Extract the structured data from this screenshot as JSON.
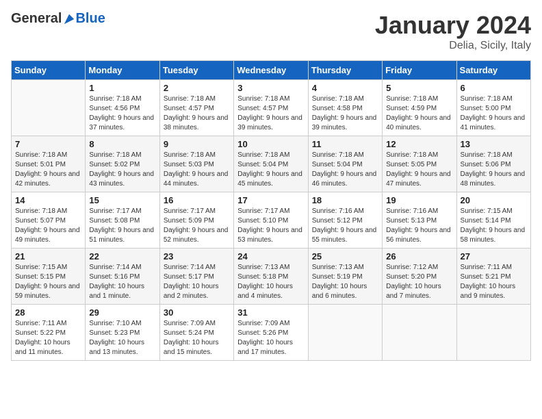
{
  "header": {
    "logo_general": "General",
    "logo_blue": "Blue",
    "month_title": "January 2024",
    "location": "Delia, Sicily, Italy"
  },
  "weekdays": [
    "Sunday",
    "Monday",
    "Tuesday",
    "Wednesday",
    "Thursday",
    "Friday",
    "Saturday"
  ],
  "weeks": [
    [
      {
        "day": "",
        "sunrise": "",
        "sunset": "",
        "daylight": ""
      },
      {
        "day": "1",
        "sunrise": "Sunrise: 7:18 AM",
        "sunset": "Sunset: 4:56 PM",
        "daylight": "Daylight: 9 hours and 37 minutes."
      },
      {
        "day": "2",
        "sunrise": "Sunrise: 7:18 AM",
        "sunset": "Sunset: 4:57 PM",
        "daylight": "Daylight: 9 hours and 38 minutes."
      },
      {
        "day": "3",
        "sunrise": "Sunrise: 7:18 AM",
        "sunset": "Sunset: 4:57 PM",
        "daylight": "Daylight: 9 hours and 39 minutes."
      },
      {
        "day": "4",
        "sunrise": "Sunrise: 7:18 AM",
        "sunset": "Sunset: 4:58 PM",
        "daylight": "Daylight: 9 hours and 39 minutes."
      },
      {
        "day": "5",
        "sunrise": "Sunrise: 7:18 AM",
        "sunset": "Sunset: 4:59 PM",
        "daylight": "Daylight: 9 hours and 40 minutes."
      },
      {
        "day": "6",
        "sunrise": "Sunrise: 7:18 AM",
        "sunset": "Sunset: 5:00 PM",
        "daylight": "Daylight: 9 hours and 41 minutes."
      }
    ],
    [
      {
        "day": "7",
        "sunrise": "Sunrise: 7:18 AM",
        "sunset": "Sunset: 5:01 PM",
        "daylight": "Daylight: 9 hours and 42 minutes."
      },
      {
        "day": "8",
        "sunrise": "Sunrise: 7:18 AM",
        "sunset": "Sunset: 5:02 PM",
        "daylight": "Daylight: 9 hours and 43 minutes."
      },
      {
        "day": "9",
        "sunrise": "Sunrise: 7:18 AM",
        "sunset": "Sunset: 5:03 PM",
        "daylight": "Daylight: 9 hours and 44 minutes."
      },
      {
        "day": "10",
        "sunrise": "Sunrise: 7:18 AM",
        "sunset": "Sunset: 5:04 PM",
        "daylight": "Daylight: 9 hours and 45 minutes."
      },
      {
        "day": "11",
        "sunrise": "Sunrise: 7:18 AM",
        "sunset": "Sunset: 5:04 PM",
        "daylight": "Daylight: 9 hours and 46 minutes."
      },
      {
        "day": "12",
        "sunrise": "Sunrise: 7:18 AM",
        "sunset": "Sunset: 5:05 PM",
        "daylight": "Daylight: 9 hours and 47 minutes."
      },
      {
        "day": "13",
        "sunrise": "Sunrise: 7:18 AM",
        "sunset": "Sunset: 5:06 PM",
        "daylight": "Daylight: 9 hours and 48 minutes."
      }
    ],
    [
      {
        "day": "14",
        "sunrise": "Sunrise: 7:18 AM",
        "sunset": "Sunset: 5:07 PM",
        "daylight": "Daylight: 9 hours and 49 minutes."
      },
      {
        "day": "15",
        "sunrise": "Sunrise: 7:17 AM",
        "sunset": "Sunset: 5:08 PM",
        "daylight": "Daylight: 9 hours and 51 minutes."
      },
      {
        "day": "16",
        "sunrise": "Sunrise: 7:17 AM",
        "sunset": "Sunset: 5:09 PM",
        "daylight": "Daylight: 9 hours and 52 minutes."
      },
      {
        "day": "17",
        "sunrise": "Sunrise: 7:17 AM",
        "sunset": "Sunset: 5:10 PM",
        "daylight": "Daylight: 9 hours and 53 minutes."
      },
      {
        "day": "18",
        "sunrise": "Sunrise: 7:16 AM",
        "sunset": "Sunset: 5:12 PM",
        "daylight": "Daylight: 9 hours and 55 minutes."
      },
      {
        "day": "19",
        "sunrise": "Sunrise: 7:16 AM",
        "sunset": "Sunset: 5:13 PM",
        "daylight": "Daylight: 9 hours and 56 minutes."
      },
      {
        "day": "20",
        "sunrise": "Sunrise: 7:15 AM",
        "sunset": "Sunset: 5:14 PM",
        "daylight": "Daylight: 9 hours and 58 minutes."
      }
    ],
    [
      {
        "day": "21",
        "sunrise": "Sunrise: 7:15 AM",
        "sunset": "Sunset: 5:15 PM",
        "daylight": "Daylight: 9 hours and 59 minutes."
      },
      {
        "day": "22",
        "sunrise": "Sunrise: 7:14 AM",
        "sunset": "Sunset: 5:16 PM",
        "daylight": "Daylight: 10 hours and 1 minute."
      },
      {
        "day": "23",
        "sunrise": "Sunrise: 7:14 AM",
        "sunset": "Sunset: 5:17 PM",
        "daylight": "Daylight: 10 hours and 2 minutes."
      },
      {
        "day": "24",
        "sunrise": "Sunrise: 7:13 AM",
        "sunset": "Sunset: 5:18 PM",
        "daylight": "Daylight: 10 hours and 4 minutes."
      },
      {
        "day": "25",
        "sunrise": "Sunrise: 7:13 AM",
        "sunset": "Sunset: 5:19 PM",
        "daylight": "Daylight: 10 hours and 6 minutes."
      },
      {
        "day": "26",
        "sunrise": "Sunrise: 7:12 AM",
        "sunset": "Sunset: 5:20 PM",
        "daylight": "Daylight: 10 hours and 7 minutes."
      },
      {
        "day": "27",
        "sunrise": "Sunrise: 7:11 AM",
        "sunset": "Sunset: 5:21 PM",
        "daylight": "Daylight: 10 hours and 9 minutes."
      }
    ],
    [
      {
        "day": "28",
        "sunrise": "Sunrise: 7:11 AM",
        "sunset": "Sunset: 5:22 PM",
        "daylight": "Daylight: 10 hours and 11 minutes."
      },
      {
        "day": "29",
        "sunrise": "Sunrise: 7:10 AM",
        "sunset": "Sunset: 5:23 PM",
        "daylight": "Daylight: 10 hours and 13 minutes."
      },
      {
        "day": "30",
        "sunrise": "Sunrise: 7:09 AM",
        "sunset": "Sunset: 5:24 PM",
        "daylight": "Daylight: 10 hours and 15 minutes."
      },
      {
        "day": "31",
        "sunrise": "Sunrise: 7:09 AM",
        "sunset": "Sunset: 5:26 PM",
        "daylight": "Daylight: 10 hours and 17 minutes."
      },
      {
        "day": "",
        "sunrise": "",
        "sunset": "",
        "daylight": ""
      },
      {
        "day": "",
        "sunrise": "",
        "sunset": "",
        "daylight": ""
      },
      {
        "day": "",
        "sunrise": "",
        "sunset": "",
        "daylight": ""
      }
    ]
  ]
}
